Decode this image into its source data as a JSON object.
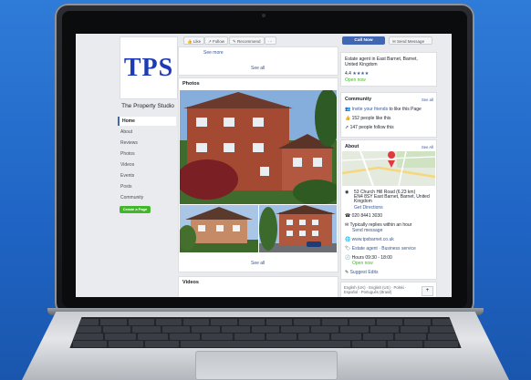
{
  "page": {
    "name": "The Property Studio",
    "logo_text": "TPS",
    "nav": [
      "Home",
      "About",
      "Reviews",
      "Photos",
      "Videos",
      "Events",
      "Posts",
      "Community"
    ],
    "create_page": "Create a Page"
  },
  "actions": {
    "like": "Like",
    "follow": "Follow",
    "recommend": "Recommend",
    "more": "···",
    "call_now": "Call Now",
    "send_message": "Send Message"
  },
  "center": {
    "see_more": "See more",
    "see_all_top": "See all",
    "photos_title": "Photos",
    "see_all_photos": "See all",
    "videos_title": "Videos"
  },
  "right": {
    "category": "Estate agent in East Barnet, Barnet, United Kingdom",
    "rating": "4.4",
    "stars": "★★★★",
    "open_now": "Open now",
    "community_title": "Community",
    "community_see_all": "See all",
    "invite_prefix": "Invite your friends",
    "invite_suffix": " to like this Page",
    "likes": "152 people like this",
    "follows": "147 people follow this",
    "about_title": "About",
    "about_see_all": "See All",
    "address1": "53 Church Hill Road (6.23 km)",
    "address2": "EN4 8SY East Barnet, Barnet, United Kingdom",
    "directions": "Get Directions",
    "phone": "020 8441 3030",
    "reply": "Typically replies within an hour",
    "send_message": "Send message",
    "website": "www.tpsbarnet.co.uk",
    "categories": "Estate agent · Business service",
    "hours": "Hours 09:30 - 18:00",
    "hours_status": "Open now",
    "suggest_edits": "Suggest Edits",
    "languages": "English (UK) · English (US) · Polski · Español · Português (Brasil)",
    "plus": "+"
  }
}
